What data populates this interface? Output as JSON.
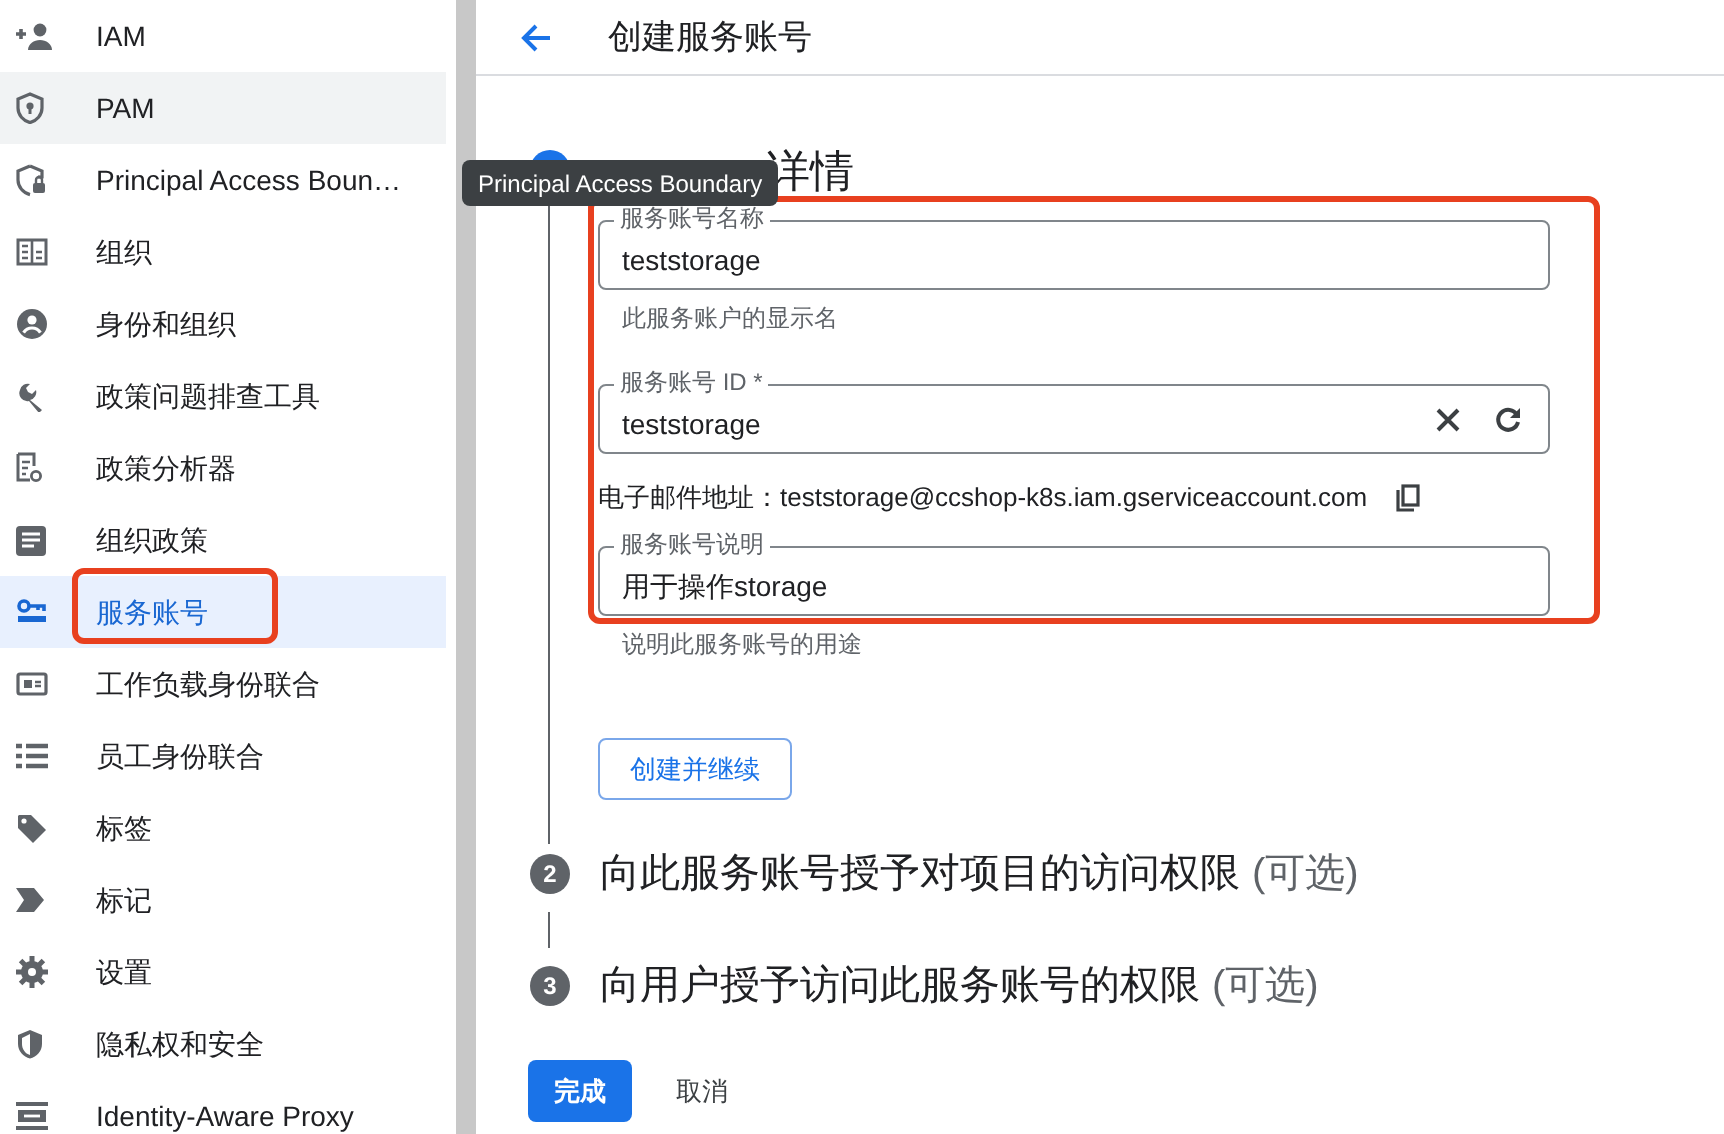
{
  "sidebar": {
    "items": [
      {
        "label": "IAM",
        "selected": false
      },
      {
        "label": "PAM",
        "selected": false,
        "hovered": true
      },
      {
        "label": "Principal Access Boun…",
        "selected": false
      },
      {
        "label": "组织",
        "selected": false
      },
      {
        "label": "身份和组织",
        "selected": false
      },
      {
        "label": "政策问题排查工具",
        "selected": false
      },
      {
        "label": "政策分析器",
        "selected": false
      },
      {
        "label": "组织政策",
        "selected": false
      },
      {
        "label": "服务账号",
        "selected": true,
        "annotated": true
      },
      {
        "label": "工作负载身份联合",
        "selected": false
      },
      {
        "label": "员工身份联合",
        "selected": false
      },
      {
        "label": "标签",
        "selected": false
      },
      {
        "label": "标记",
        "selected": false
      },
      {
        "label": "设置",
        "selected": false
      },
      {
        "label": "隐私权和安全",
        "selected": false
      },
      {
        "label": "Identity-Aware Proxy",
        "selected": false
      }
    ]
  },
  "tooltip": "Principal Access Boundary",
  "header": {
    "title": "创建服务账号"
  },
  "steps": [
    {
      "title": "详情",
      "active": true
    },
    {
      "number": "2",
      "title": "向此服务账号授予对项目的访问权限",
      "suffix": "(可选)",
      "active": false
    },
    {
      "number": "3",
      "title": "向用户授予访问此服务账号的权限",
      "suffix": "(可选)",
      "active": false
    }
  ],
  "form": {
    "annotated": true,
    "name_field": {
      "label": "服务账号名称",
      "value": "teststorage",
      "helper": "此服务账户的显示名"
    },
    "id_field": {
      "label": "服务账号 ID *",
      "value": "teststorage"
    },
    "email": {
      "label": "电子邮件地址：",
      "value": "teststorage@ccshop-k8s.iam.gserviceaccount.com"
    },
    "description_field": {
      "label": "服务账号说明",
      "value": "用于操作storage",
      "helper": "说明此服务账号的用途"
    },
    "submit": "创建并继续"
  },
  "actions": {
    "done": "完成",
    "cancel": "取消"
  }
}
